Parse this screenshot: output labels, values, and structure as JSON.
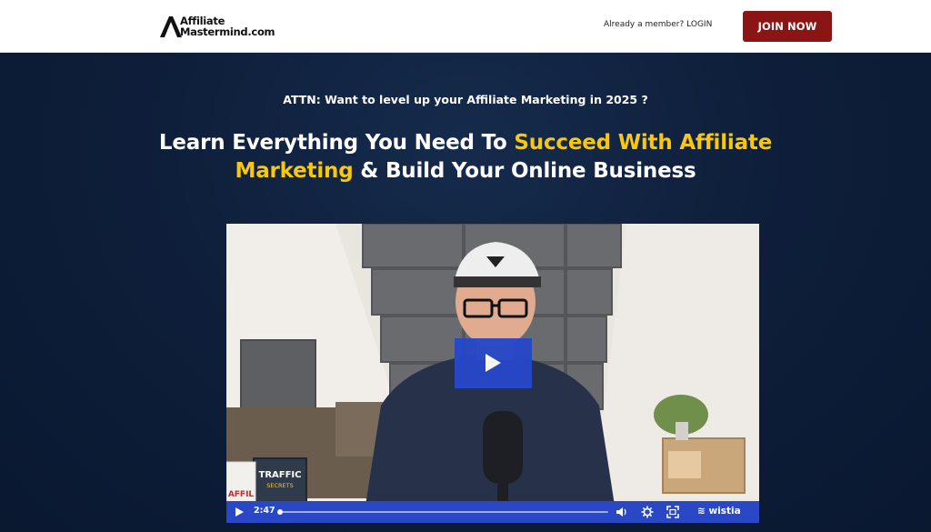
{
  "header": {
    "logo_line1": "Affiliate",
    "logo_line2": "Mastermind.com",
    "member_prompt": "Already a member?",
    "login_label": "LOGIN",
    "join_label": "JOIN NOW"
  },
  "hero": {
    "attn": "ATTN: Want to level up your Affiliate Marketing in 2025 ?",
    "headline_part1": "Learn Everything You Need To ",
    "headline_highlight1": "Succeed With Affiliate",
    "headline_highlight2": "Marketing",
    "headline_part2": " & Build Your Online Business"
  },
  "video": {
    "time": "2:47",
    "progress": 0.0,
    "brand": "wistia",
    "book_text1": "TRAFFIC",
    "book_text2": "SECRETS",
    "book_spine": "AFFIL"
  },
  "colors": {
    "accent_yellow": "#f9c80e",
    "join_red": "#8b1414",
    "player_blue": "#2a48c6",
    "hero_bg": "#0e1f3b"
  }
}
